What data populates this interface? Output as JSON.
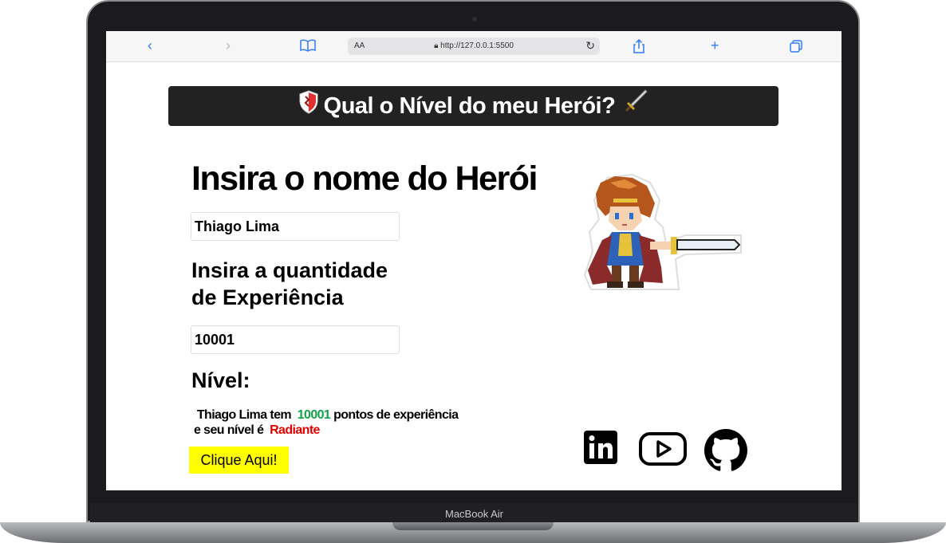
{
  "browser": {
    "reader_label": "AA",
    "url": "http://127.0.0.1:5500"
  },
  "page": {
    "header_title": "Qual o Nível do meu Herói?",
    "name_heading": "Insira o nome do Herói",
    "name_value": "Thiago Lima",
    "xp_heading_line1": "Insira a quantidade",
    "xp_heading_line2": "de Experiência",
    "xp_value": "10001",
    "level_heading": "Nível:",
    "result": {
      "name": "Thiago Lima",
      "has_text": "tem",
      "xp": "10001",
      "points_text": "pontos de experiência",
      "level_text": "e seu nível é",
      "rank": "Radiante"
    },
    "button_label": "Clique Aqui!"
  },
  "device": {
    "label": "MacBook Air"
  },
  "colors": {
    "header_bg": "#222222",
    "xp_color": "#12a14a",
    "rank_color": "#e00000",
    "button_bg": "#ffff00",
    "browser_accent": "#2f7cf6"
  },
  "icons": {
    "header_left": "shield-icon",
    "header_right": "sword-icon",
    "social": [
      "linkedin-icon",
      "youtube-icon",
      "github-icon"
    ]
  }
}
